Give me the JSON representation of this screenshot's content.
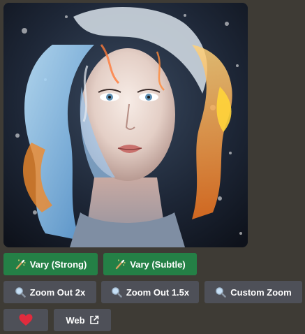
{
  "image": {
    "alt": "",
    "icon": "generated-portrait-image"
  },
  "actions": {
    "vary_strong": {
      "label": "Vary (Strong)",
      "icon": "magic-wand-icon"
    },
    "vary_subtle": {
      "label": "Vary (Subtle)",
      "icon": "magic-wand-icon"
    },
    "zoom_out_2x": {
      "label": "Zoom Out 2x",
      "icon": "magnifier-icon"
    },
    "zoom_out_15x": {
      "label": "Zoom Out 1.5x",
      "icon": "magnifier-icon"
    },
    "custom_zoom": {
      "label": "Custom Zoom",
      "icon": "magnifier-icon"
    },
    "favorite": {
      "icon": "heart-icon"
    },
    "web": {
      "label": "Web",
      "icon": "external-link-icon"
    }
  },
  "colors": {
    "background": "#3e3b35",
    "button_green": "#248046",
    "button_grey": "#4e5058",
    "heart": "#e02b3d"
  }
}
